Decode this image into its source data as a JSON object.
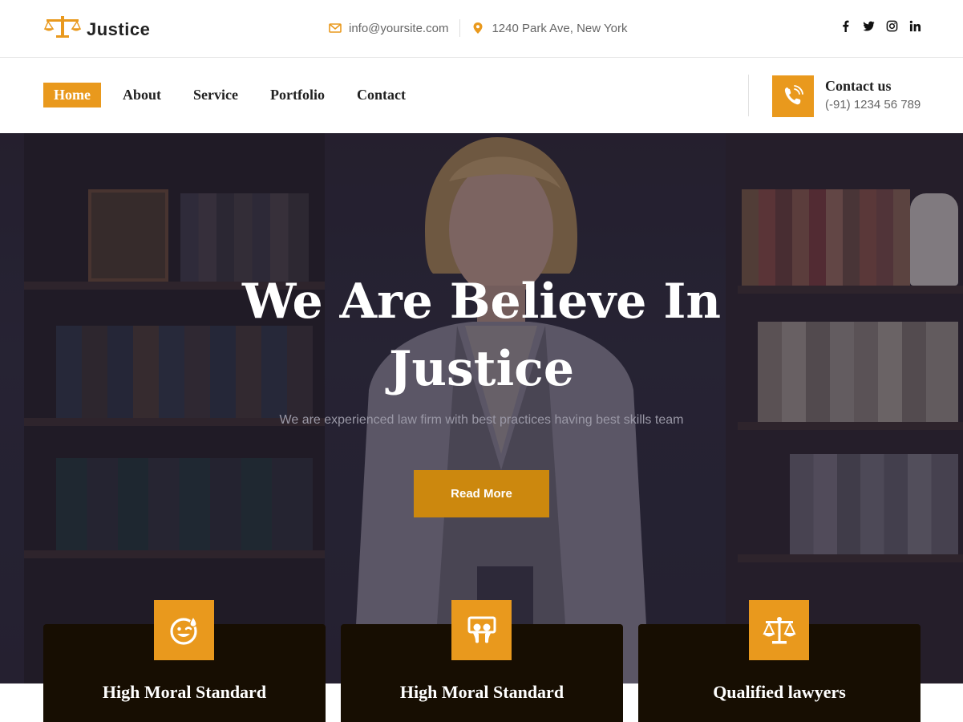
{
  "brand": {
    "name": "Justice",
    "icon": "scales-icon",
    "accent_color": "#e9991d"
  },
  "topbar": {
    "email": "info@yoursite.com",
    "address": "1240 Park Ave, New York",
    "social": [
      "facebook-icon",
      "twitter-icon",
      "instagram-icon",
      "linkedin-icon"
    ]
  },
  "nav": {
    "items": [
      {
        "label": "Home",
        "active": true
      },
      {
        "label": "About",
        "active": false
      },
      {
        "label": "Service",
        "active": false
      },
      {
        "label": "Portfolio",
        "active": false
      },
      {
        "label": "Contact",
        "active": false
      }
    ],
    "contact": {
      "title": "Contact us",
      "phone": "(-91) 1234 56 789",
      "icon": "phone-icon"
    }
  },
  "hero": {
    "title_line1": "We Are Believe In",
    "title_line2": "Justice",
    "subtitle": "We are experienced law firm with best practices having best skills team",
    "button_label": "Read More"
  },
  "features": [
    {
      "title": "High Moral Standard",
      "icon": "smile-icon"
    },
    {
      "title": "High Moral Standard",
      "icon": "slideshare-icon"
    },
    {
      "title": "Qualified lawyers",
      "icon": "balance-scale-icon"
    }
  ]
}
